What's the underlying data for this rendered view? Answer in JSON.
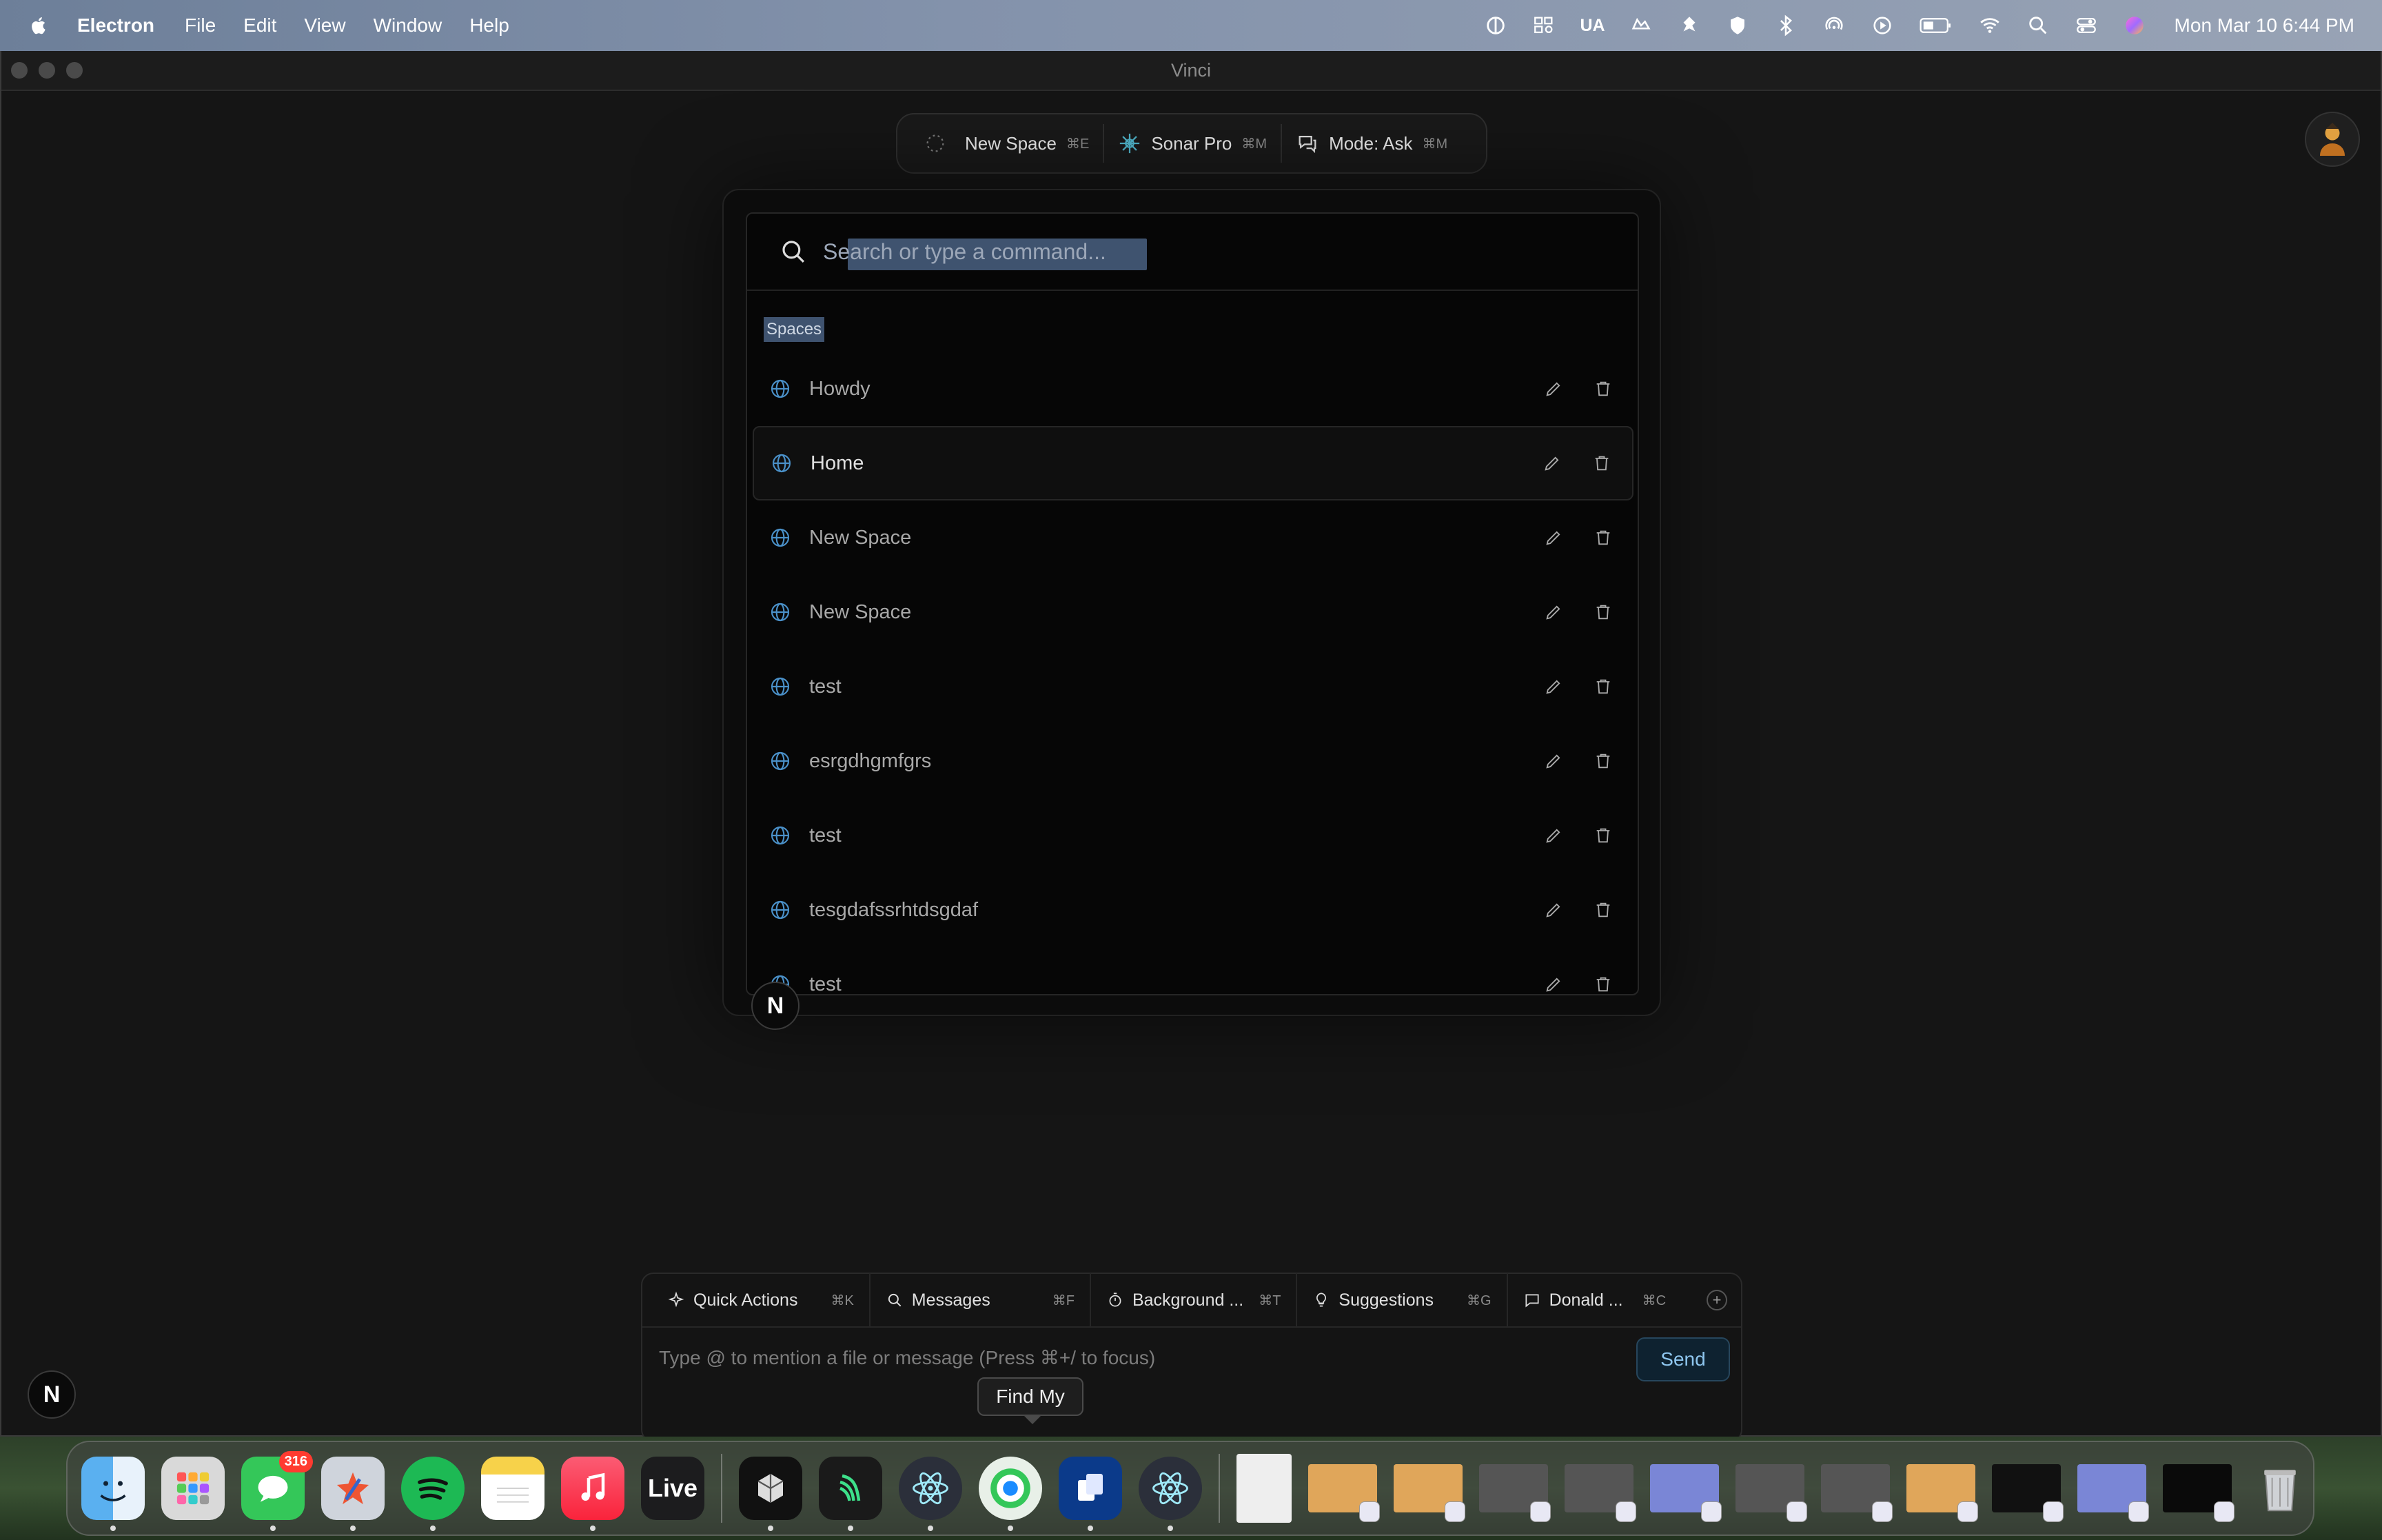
{
  "menubar": {
    "app_name": "Electron",
    "menus": [
      "File",
      "Edit",
      "View",
      "Window",
      "Help"
    ],
    "input_source": "UA",
    "clock": "Mon Mar 10  6:44 PM"
  },
  "window": {
    "title": "Vinci"
  },
  "top_pill": {
    "space_label": "New Space",
    "space_kbd": "⌘E",
    "model_label": "Sonar Pro",
    "model_kbd": "⌘M",
    "mode_label": "Mode: Ask",
    "mode_kbd": "⌘M"
  },
  "palette": {
    "search_placeholder": "Search or type a command...",
    "section_label": "Spaces",
    "items": [
      {
        "label": "Howdy"
      },
      {
        "label": "Home"
      },
      {
        "label": "New Space"
      },
      {
        "label": "New Space"
      },
      {
        "label": "test"
      },
      {
        "label": "esrgdhgmfgrs"
      },
      {
        "label": "test"
      },
      {
        "label": "tesgdafssrhtdsgdaf"
      },
      {
        "label": "test"
      }
    ]
  },
  "composer": {
    "chips": [
      {
        "label": "Quick Actions",
        "kbd": "⌘K"
      },
      {
        "label": "Messages",
        "kbd": "⌘F"
      },
      {
        "label": "Background ...",
        "kbd": "⌘T"
      },
      {
        "label": "Suggestions",
        "kbd": "⌘G"
      },
      {
        "label": "Donald ...",
        "kbd": "⌘C"
      }
    ],
    "placeholder": "Type @ to mention a file or message (Press ⌘+/ to focus)",
    "send_label": "Send"
  },
  "badge_n": "N",
  "tooltip": "Find My",
  "dock": {
    "messages_badge": "316",
    "live_label": "Live"
  },
  "colors": {
    "accent_blue": "#4a90c8",
    "selection": "#3f536f",
    "send_text": "#8ec6ee"
  }
}
